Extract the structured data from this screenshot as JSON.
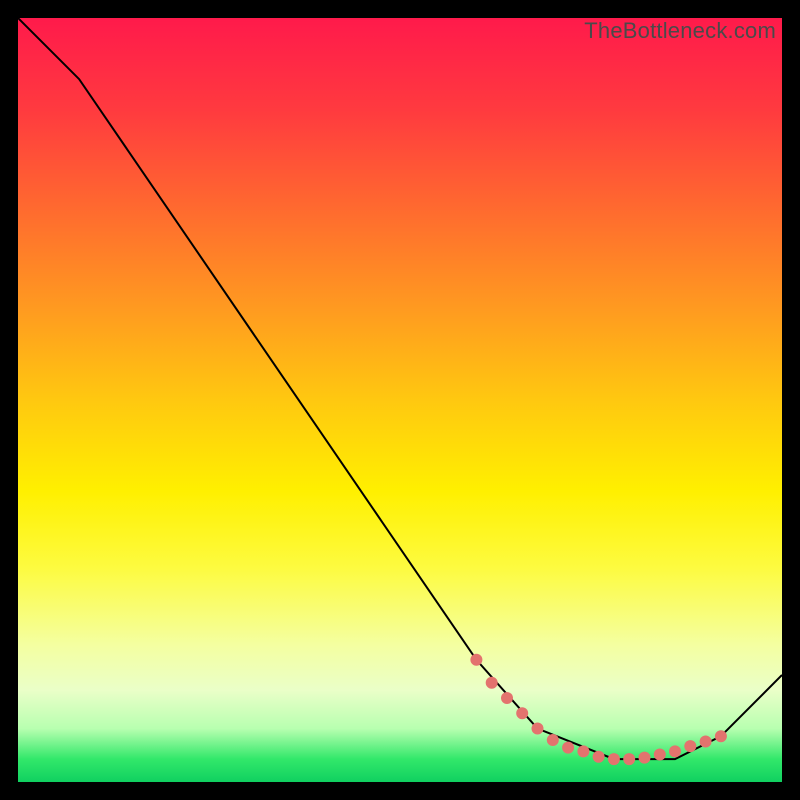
{
  "watermark": "TheBottleneck.com",
  "chart_data": {
    "type": "line",
    "title": "",
    "xlabel": "",
    "ylabel": "",
    "xlim": [
      0,
      100
    ],
    "ylim": [
      0,
      100
    ],
    "series": [
      {
        "name": "curve",
        "x": [
          0,
          8,
          60,
          68,
          78,
          86,
          92,
          100
        ],
        "y": [
          100,
          92,
          16,
          7,
          3,
          3,
          6,
          14
        ]
      }
    ],
    "markers": {
      "name": "highlight-zone",
      "x": [
        60,
        62,
        64,
        66,
        68,
        70,
        72,
        74,
        76,
        78,
        80,
        82,
        84,
        86,
        88,
        90,
        92
      ],
      "y": [
        16,
        13,
        11,
        9,
        7,
        5.5,
        4.5,
        4,
        3.3,
        3,
        3,
        3.2,
        3.6,
        4,
        4.7,
        5.3,
        6
      ]
    },
    "colors": {
      "curve": "#000000",
      "marker": "#e3736e",
      "gradient_top": "#ff1a4b",
      "gradient_bottom": "#10d060"
    }
  }
}
